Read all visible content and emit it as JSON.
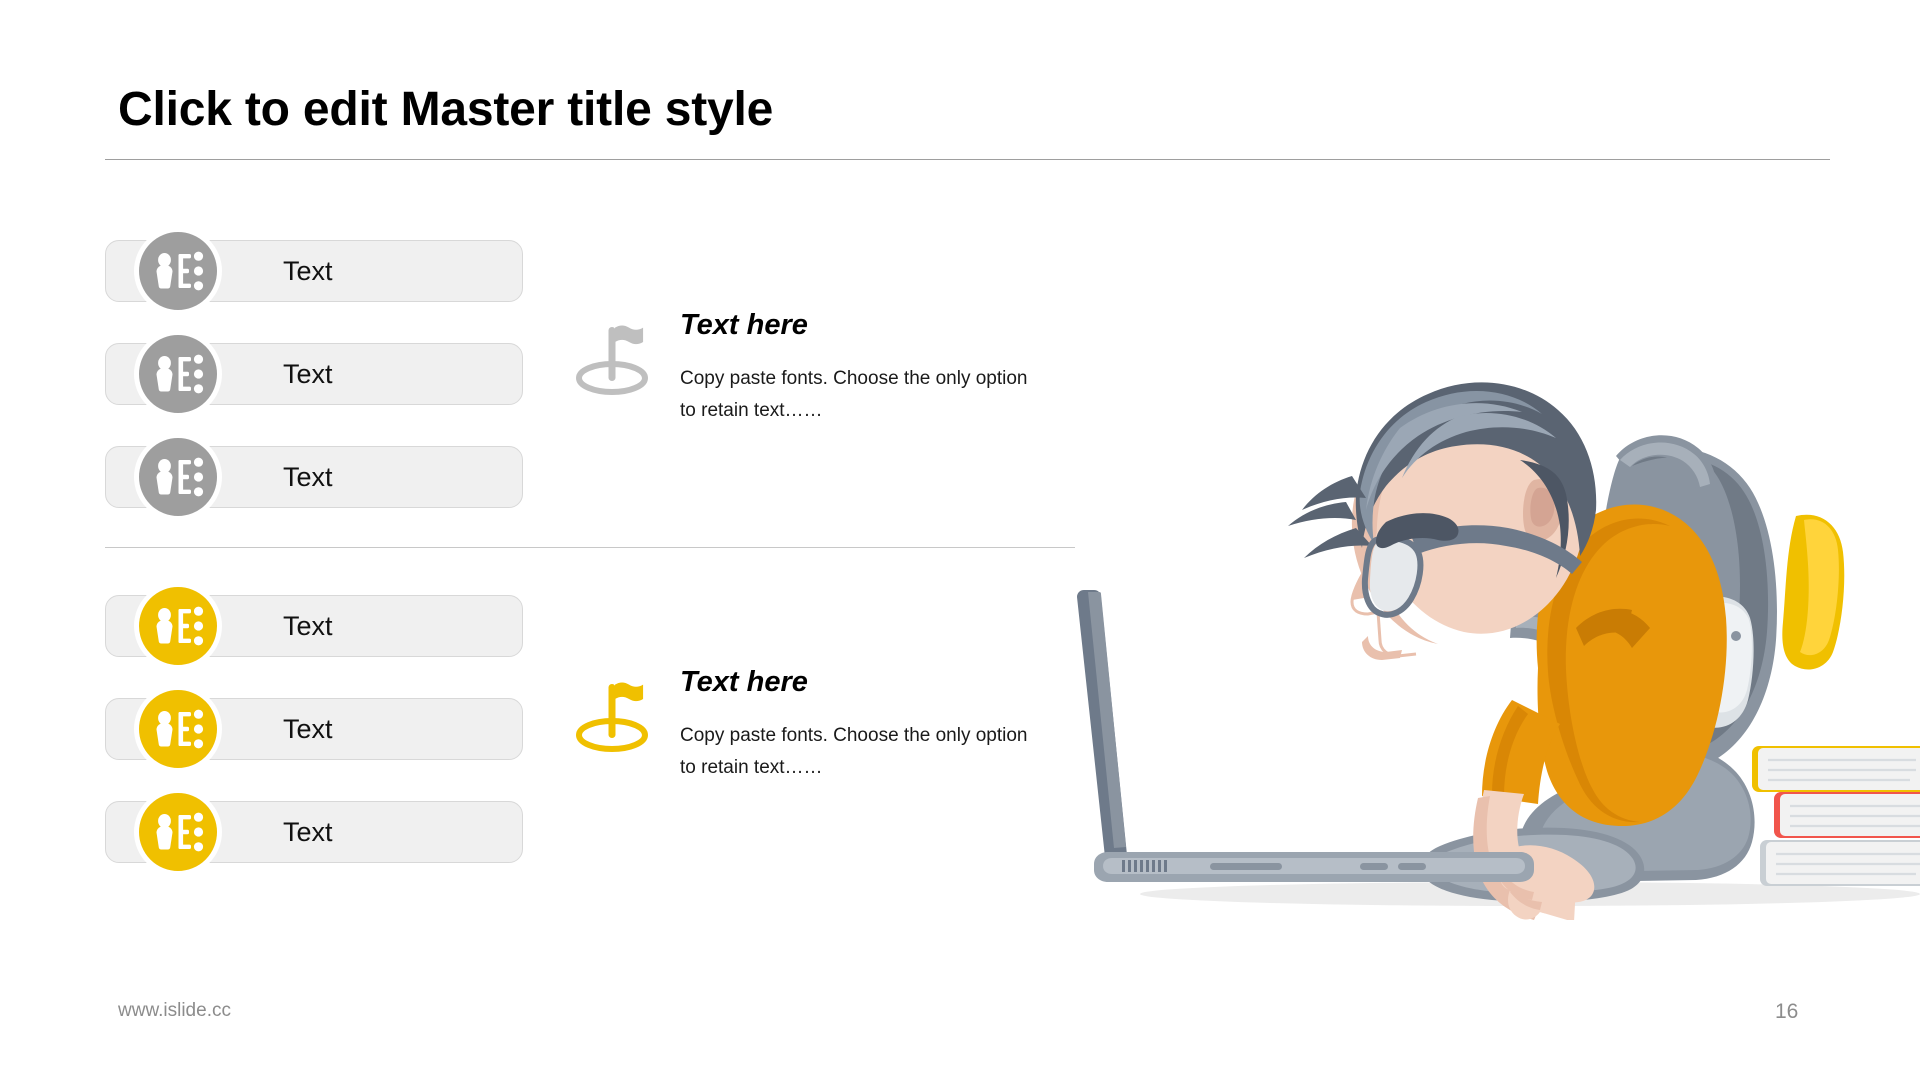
{
  "slide": {
    "title": "Click to edit Master title style",
    "background_color": "#FFFFFF",
    "accent_yellow": "#F0C000",
    "accent_gray": "#9E9E9E",
    "page_number": "16",
    "footer_url": "www.islide.cc"
  },
  "groups": [
    {
      "id": "group-gray",
      "color": "#9E9E9E",
      "pills": [
        {
          "label": "Text",
          "icon": "person-list-icon"
        },
        {
          "label": "Text",
          "icon": "person-list-icon"
        },
        {
          "label": "Text",
          "icon": "person-list-icon"
        }
      ],
      "feature": {
        "icon": "flag-outline-icon",
        "title": "Text here",
        "body": "Copy paste fonts. Choose the only option to retain text……"
      }
    },
    {
      "id": "group-yellow",
      "color": "#F0C000",
      "pills": [
        {
          "label": "Text",
          "icon": "person-list-icon"
        },
        {
          "label": "Text",
          "icon": "person-list-icon"
        },
        {
          "label": "Text",
          "icon": "person-list-icon"
        }
      ],
      "feature": {
        "icon": "flag-filled-icon",
        "title": "Text here",
        "body": "Copy paste fonts. Choose the only option to retain text……"
      }
    }
  ],
  "illustration": {
    "name": "student-sitting-with-laptop-illustration",
    "alt": "Student with glasses and backpack sitting cross-legged using a laptop next to a stack of books",
    "colors": {
      "hair": "#5A6472",
      "hair_light": "#8794A3",
      "skin": "#F3D3C2",
      "shirt": "#E8970B",
      "backpack": "#8A94A0",
      "pants": "#8A94A0",
      "book_yellow": "#F0C000",
      "book_red": "#F1554C",
      "book_gray": "#C9CFD4",
      "laptop": "#6E7A8A"
    }
  }
}
